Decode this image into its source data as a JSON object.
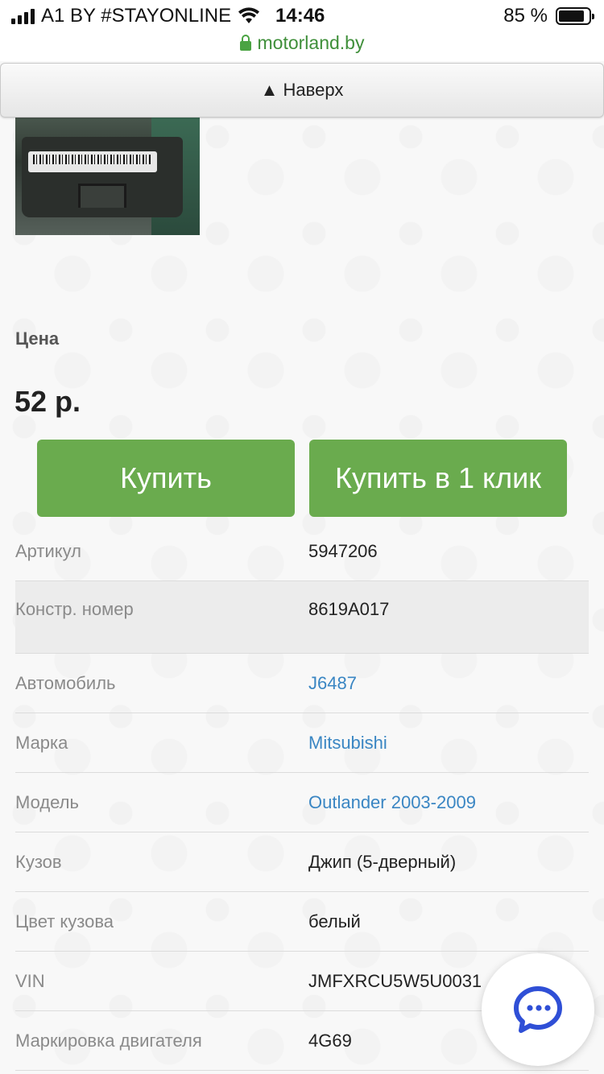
{
  "status_bar": {
    "carrier": "A1 BY #STAYONLINE",
    "time": "14:46",
    "battery_text": "85 %",
    "battery_level": 0.85
  },
  "browser": {
    "url": "motorland.by"
  },
  "top_button": {
    "label": "▲ Наверх"
  },
  "product": {
    "price_label": "Цена",
    "price_value": "52 р.",
    "buy_label": "Купить",
    "buy_one_click_label": "Купить в 1 клик"
  },
  "specs": [
    {
      "key": "Артикул",
      "value": "5947206",
      "link": false
    },
    {
      "key": "Констр. номер",
      "value": "8619A017",
      "link": false
    },
    {
      "key": "Автомобиль",
      "value": "J6487",
      "link": true
    },
    {
      "key": "Марка",
      "value": "Mitsubishi",
      "link": true
    },
    {
      "key": "Модель",
      "value": "Outlander 2003-2009",
      "link": true
    },
    {
      "key": "Кузов",
      "value": "Джип (5-дверный)",
      "link": false
    },
    {
      "key": "Цвет кузова",
      "value": "белый",
      "link": false
    },
    {
      "key": "VIN",
      "value": "JMFXRCU5W5U0031",
      "link": false
    },
    {
      "key": "Маркировка двигателя",
      "value": "4G69",
      "link": false
    }
  ],
  "colors": {
    "accent_green": "#6aab4e",
    "link_blue": "#3a86c3",
    "chat_blue": "#2f4fd6"
  }
}
